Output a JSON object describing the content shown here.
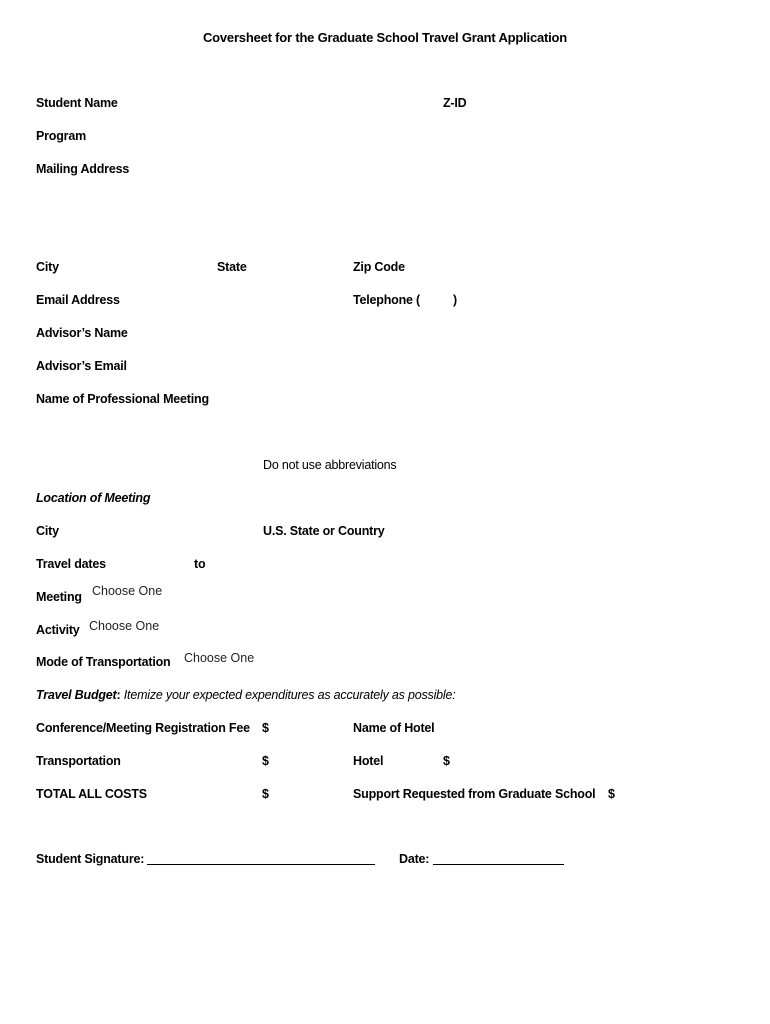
{
  "document": {
    "title": "Coversheet for the Graduate School Travel Grant Application"
  },
  "student": {
    "name_label": "Student Name",
    "zid_label": "Z-ID",
    "program_label": "Program",
    "mailing_address_label": "Mailing Address",
    "city_label": "City",
    "state_label": "State",
    "zip_label": "Zip Code",
    "email_label": "Email Address",
    "telephone_label": "Telephone (",
    "telephone_close": ")",
    "advisor_name_label": "Advisor’s Name",
    "advisor_email_label": "Advisor’s Email"
  },
  "meeting": {
    "name_label": "Name of Professional Meeting",
    "abbrev_note": "Do not use abbreviations",
    "location_heading": "Location of Meeting",
    "city_label": "City",
    "state_country_label": "U.S. State or Country",
    "travel_dates_label": "Travel dates",
    "to_label": "to",
    "meeting_label": "Meeting",
    "meeting_value": "Choose One",
    "activity_label": "Activity",
    "activity_value": "Choose One",
    "transport_mode_label": "Mode of Transportation",
    "transport_mode_value": "Choose One"
  },
  "budget": {
    "heading_bold": "Travel Budget",
    "heading_colon": ":",
    "heading_rest": " Itemize your expected expenditures as accurately as possible:",
    "registration_label": "Conference/Meeting Registration Fee",
    "transportation_label": "Transportation",
    "total_label": "TOTAL ALL COSTS",
    "hotel_name_label": "Name of Hotel",
    "hotel_label": "Hotel",
    "support_label": "Support Requested from Graduate School",
    "currency": "$"
  },
  "signature": {
    "signature_label": "Student Signature:",
    "date_label": "Date:"
  }
}
